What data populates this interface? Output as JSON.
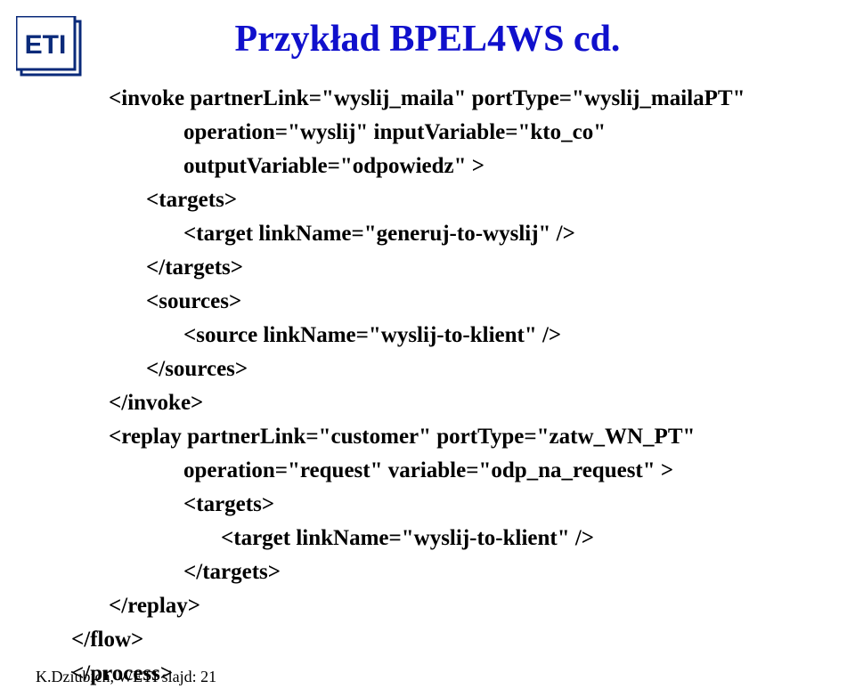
{
  "title": "Przykład BPEL4WS cd.",
  "code": {
    "l01": "<invoke partnerLink=\"wyslij_maila\" portType=\"wyslij_mailaPT\"",
    "l02": "operation=\"wyslij\" inputVariable=\"kto_co\"",
    "l03": "outputVariable=\"odpowiedz\" >",
    "l04": "<targets>",
    "l05": "<target linkName=\"generuj-to-wyslij\" />",
    "l06": "</targets>",
    "l07": "<sources>",
    "l08": "<source linkName=\"wyslij-to-klient\" />",
    "l09": "</sources>",
    "l10": "</invoke>",
    "l11": "<replay partnerLink=\"customer\" portType=\"zatw_WN_PT\"",
    "l12": "operation=\"request\" variable=\"odp_na_request\" >",
    "l13": "<targets>",
    "l14": "<target linkName=\"wyslij-to-klient\" />",
    "l15": "</targets>",
    "l16": "</replay>",
    "l17": "</flow>",
    "l18": "</process>"
  },
  "footer": "K.Dziubich, WETI slajd: 21"
}
